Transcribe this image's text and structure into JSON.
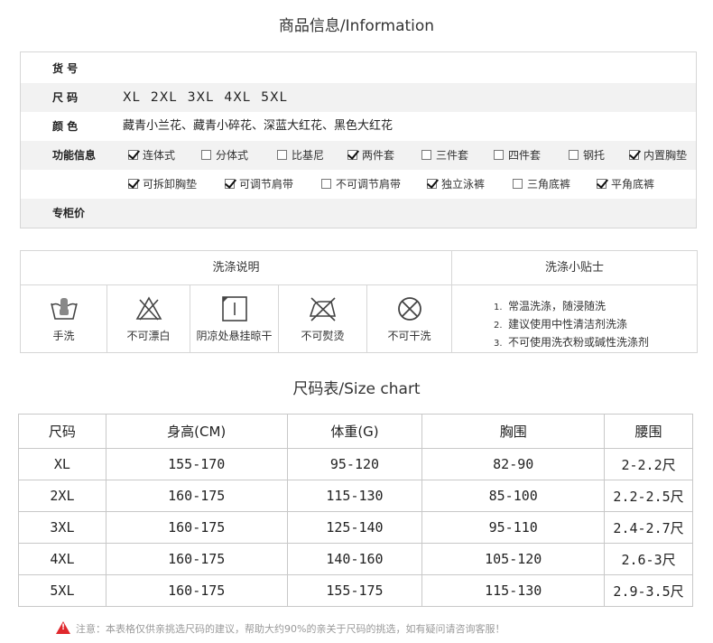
{
  "product_info": {
    "title": "商品信息/Information",
    "rows": {
      "item_no": {
        "label": "货 号",
        "value": ""
      },
      "size": {
        "label": "尺 码",
        "value": "XL 2XL 3XL 4XL 5XL"
      },
      "color": {
        "label": "颜 色",
        "value": "藏青小兰花、藏青小碎花、深蓝大红花、黑色大红花"
      },
      "features": {
        "label": "功能信息"
      },
      "price": {
        "label": "专柜价",
        "value": ""
      }
    },
    "options": [
      {
        "label": "连体式",
        "checked": true
      },
      {
        "label": "分体式",
        "checked": false
      },
      {
        "label": "比基尼",
        "checked": false
      },
      {
        "label": "两件套",
        "checked": true
      },
      {
        "label": "三件套",
        "checked": false
      },
      {
        "label": "四件套",
        "checked": false
      },
      {
        "label": "钢托",
        "checked": false
      },
      {
        "label": "内置胸垫",
        "checked": true
      },
      {
        "label": "可拆卸胸垫",
        "checked": true
      },
      {
        "label": "可调节肩带",
        "checked": true
      },
      {
        "label": "不可调节肩带",
        "checked": false
      },
      {
        "label": "独立泳裤",
        "checked": true
      },
      {
        "label": "三角底裤",
        "checked": false
      },
      {
        "label": "平角底裤",
        "checked": true
      }
    ]
  },
  "wash": {
    "instructions_title": "洗涤说明",
    "tips_title": "洗涤小贴士",
    "items": [
      {
        "label": "手洗",
        "icon": "hand-wash-icon"
      },
      {
        "label": "不可漂白",
        "icon": "no-bleach-icon"
      },
      {
        "label": "阴凉处悬挂晾干",
        "icon": "hang-dry-shade-icon"
      },
      {
        "label": "不可熨烫",
        "icon": "no-iron-icon"
      },
      {
        "label": "不可干洗",
        "icon": "no-dry-clean-icon"
      }
    ],
    "tips": [
      {
        "num": "1.",
        "text": "常温洗涤，随浸随洗"
      },
      {
        "num": "2.",
        "text": "建议使用中性清洁剂洗涤"
      },
      {
        "num": "3.",
        "text": "不可使用洗衣粉或碱性洗涤剂"
      }
    ]
  },
  "size_chart": {
    "title": "尺码表/Size chart",
    "headers": [
      "尺码",
      "身高(CM)",
      "体重(G)",
      "胸围",
      "腰围"
    ],
    "rows": [
      [
        "XL",
        "155-170",
        "95-120",
        "82-90",
        "2-2.2尺"
      ],
      [
        "2XL",
        "160-175",
        "115-130",
        "85-100",
        "2.2-2.5尺"
      ],
      [
        "3XL",
        "160-175",
        "125-140",
        "95-110",
        "2.4-2.7尺"
      ],
      [
        "4XL",
        "160-175",
        "140-160",
        "105-120",
        "2.6-3尺"
      ],
      [
        "5XL",
        "160-175",
        "155-175",
        "115-130",
        "2.9-3.5尺"
      ]
    ]
  },
  "note": "注意：本表格仅供亲挑选尺码的建议，帮助大约90%的亲关于尺码的挑选，如有疑问请咨询客服！"
}
